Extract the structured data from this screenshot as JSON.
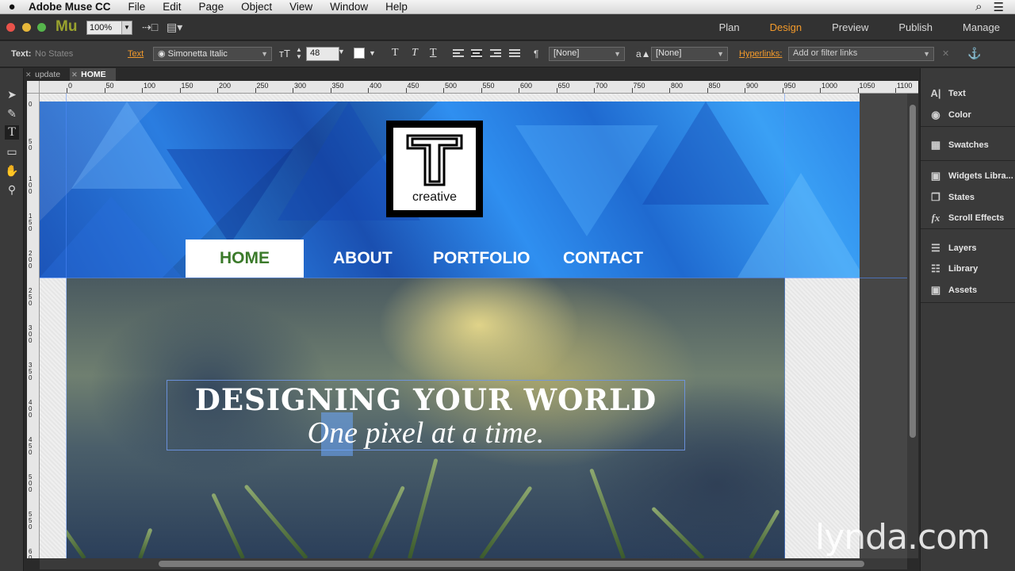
{
  "menubar": {
    "app_name": "Adobe Muse CC",
    "items": [
      "File",
      "Edit",
      "Page",
      "Object",
      "View",
      "Window",
      "Help"
    ]
  },
  "appbar": {
    "logo": "Mu",
    "zoom": "100%",
    "modes": [
      "Plan",
      "Design",
      "Preview",
      "Publish",
      "Manage"
    ],
    "active_mode": "Design"
  },
  "control_bar": {
    "text_label": "Text:",
    "states_value": "No States",
    "text_link": "Text",
    "font": "Simonetta Italic",
    "size": "48",
    "style_none_1": "[None]",
    "style_none_2": "[None]",
    "hyperlinks_label": "Hyperlinks:",
    "hyperlinks_placeholder": "Add or filter links"
  },
  "tabs": [
    "update",
    "HOME"
  ],
  "active_tab": "HOME",
  "hruler": [
    "0",
    "50",
    "100",
    "150",
    "200",
    "250",
    "300",
    "350",
    "400",
    "450",
    "500",
    "550",
    "600",
    "650",
    "700",
    "750",
    "800",
    "850",
    "900",
    "950",
    "1000",
    "1050",
    "1100"
  ],
  "vruler": [
    "0",
    "50",
    "100",
    "150",
    "200",
    "250",
    "300",
    "350",
    "400",
    "450",
    "500",
    "550",
    "600"
  ],
  "page": {
    "logo_word": "creative",
    "nav": [
      "HOME",
      "ABOUT",
      "PORTFOLIO",
      "CONTACT"
    ],
    "headline": "DESIGNING YOUR WORLD",
    "subline": "One pixel at a time."
  },
  "panel": {
    "group1": [
      "Text",
      "Color"
    ],
    "group2": [
      "Swatches"
    ],
    "group3": [
      "Widgets Libra...",
      "States",
      "Scroll Effects"
    ],
    "group4": [
      "Layers",
      "Library",
      "Assets"
    ]
  },
  "watermark": "lynda.com"
}
